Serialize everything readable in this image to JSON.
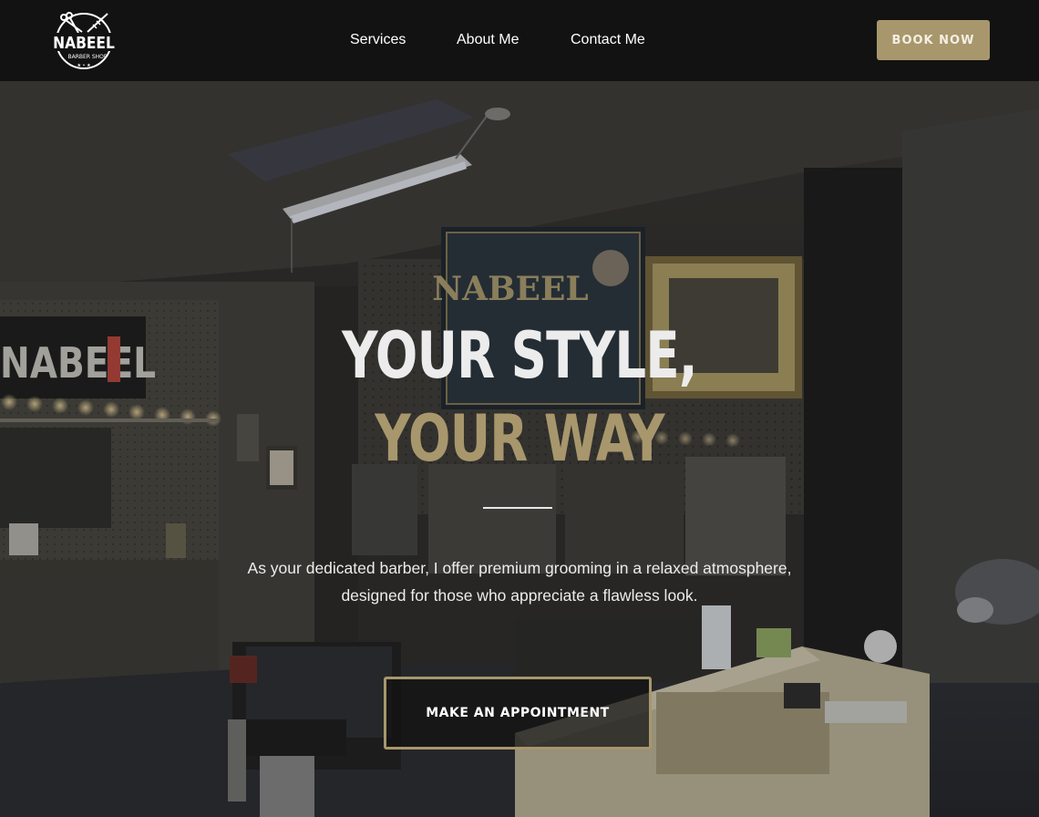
{
  "navbar": {
    "logo": {
      "name": "NABEEL",
      "subtitle": "BARBER SHOP"
    },
    "links": [
      {
        "label": "Services"
      },
      {
        "label": "About Me"
      },
      {
        "label": "Contact Me"
      }
    ],
    "book_now_label": "BOOK NOW"
  },
  "hero": {
    "title_line1": "YOUR STYLE,",
    "title_line2": "YOUR WAY",
    "description": "As your dedicated barber, I offer premium grooming in a relaxed atmosphere, designed for those who appreciate a flawless look.",
    "cta_label": "MAKE AN APPOINTMENT",
    "background_signs": {
      "left_sign": "NABEEL",
      "poster": "NABEEL"
    }
  },
  "colors": {
    "accent_gold": "#a8976c",
    "navbar_bg": "#121212",
    "text_light": "#ececec"
  },
  "icons": {
    "logo": "barber-scissors-comb-logo"
  }
}
